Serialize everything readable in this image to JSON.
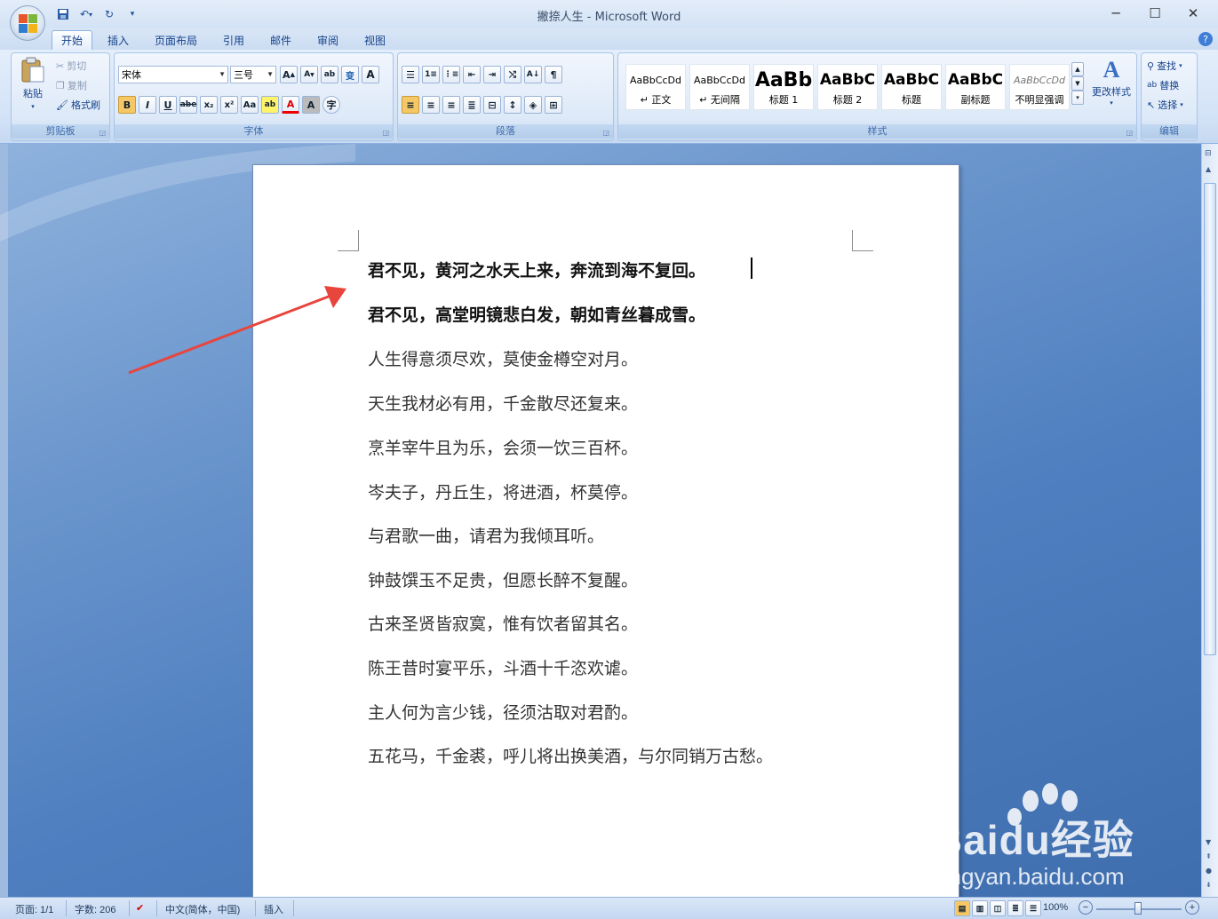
{
  "window": {
    "title": "撇捺人生 - Microsoft Word"
  },
  "tabs": [
    "开始",
    "插入",
    "页面布局",
    "引用",
    "邮件",
    "审阅",
    "视图"
  ],
  "clipboard": {
    "paste": "粘贴",
    "cut": "剪切",
    "copy": "复制",
    "format_painter": "格式刷",
    "label": "剪贴板"
  },
  "font": {
    "family": "宋体",
    "size": "三号",
    "label": "字体"
  },
  "paragraph": {
    "label": "段落"
  },
  "styles": {
    "label": "样式",
    "items": [
      {
        "sample": "AaBbCcDd",
        "name": "↵ 正文"
      },
      {
        "sample": "AaBbCcDd",
        "name": "↵ 无间隔"
      },
      {
        "sample": "AaBb",
        "name": "标题 1"
      },
      {
        "sample": "AaBbC",
        "name": "标题 2"
      },
      {
        "sample": "AaBbC",
        "name": "标题"
      },
      {
        "sample": "AaBbC",
        "name": "副标题"
      },
      {
        "sample": "AaBbCcDd",
        "name": "不明显强调"
      }
    ],
    "change": "更改样式"
  },
  "editing": {
    "find": "查找",
    "replace": "替换",
    "select": "选择",
    "label": "编辑"
  },
  "document": {
    "lines": [
      "君不见，黄河之水天上来，奔流到海不复回。",
      "君不见，高堂明镜悲白发，朝如青丝暮成雪。",
      "人生得意须尽欢，莫使金樽空对月。",
      "天生我材必有用，千金散尽还复来。",
      "烹羊宰牛且为乐，会须一饮三百杯。",
      "岑夫子，丹丘生，将进酒，杯莫停。",
      "与君歌一曲，请君为我倾耳听。",
      "钟鼓馔玉不足贵，但愿长醉不复醒。",
      "古来圣贤皆寂寞，惟有饮者留其名。",
      "陈王昔时宴平乐，斗酒十千恣欢谑。",
      "主人何为言少钱，径须沽取对君酌。",
      "五花马，千金裘，呼儿将出换美酒，与尔同销万古愁。"
    ]
  },
  "status": {
    "page": "页面: 1/1",
    "words": "字数: 206",
    "language": "中文(简体，中国)",
    "mode": "插入",
    "zoom": "100%"
  },
  "watermark": {
    "brand": "Baidu经验",
    "url": "jingyan.baidu.com"
  },
  "colors": {
    "accent": "#e8453c",
    "ribbon": "#d4e3f7",
    "workspace": "#4f7fc0"
  }
}
